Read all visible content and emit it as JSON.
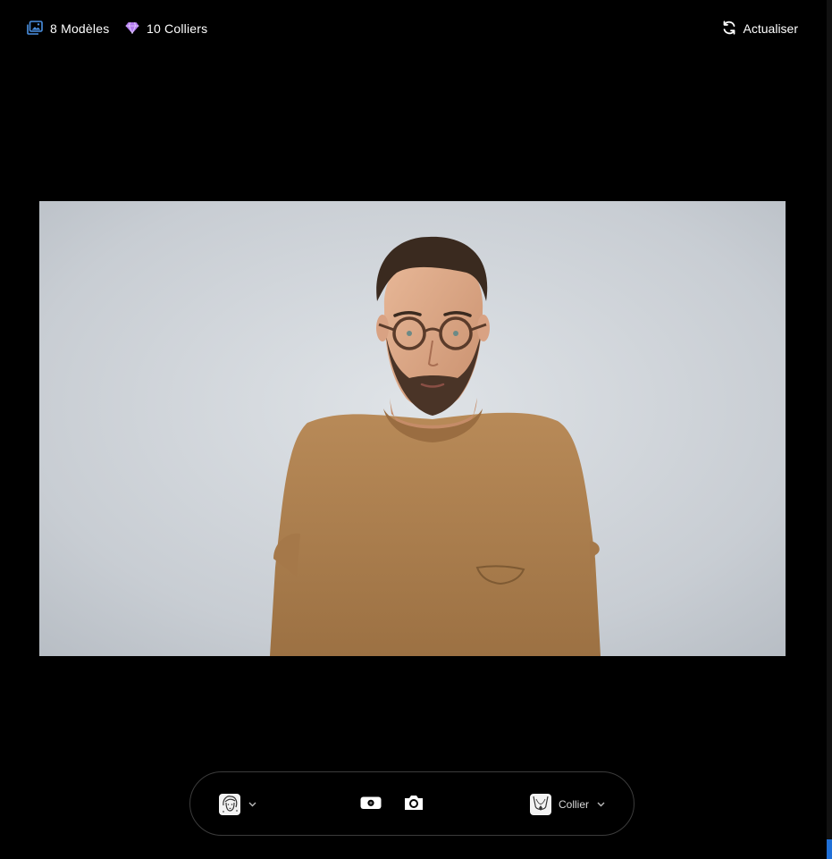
{
  "topbar": {
    "models_label": "8 Modèles",
    "models_icon": "gallery-icon",
    "gems_label": "10 Colliers",
    "gems_icon": "gem-icon",
    "refresh_label": "Actualiser",
    "refresh_icon": "refresh-icon"
  },
  "viewer": {
    "image_subject": "man-with-glasses-photo"
  },
  "controls": {
    "model_icon": "face-thumbnail-icon",
    "switch_camera_icon": "switch-camera-icon",
    "capture_icon": "camera-icon",
    "jewelry_icon": "necklace-thumbnail-icon",
    "jewelry_label": "Collier"
  },
  "colors": {
    "accent_blue": "#4a90e2",
    "gem_purple": "#b47bf0",
    "background": "#000000"
  }
}
